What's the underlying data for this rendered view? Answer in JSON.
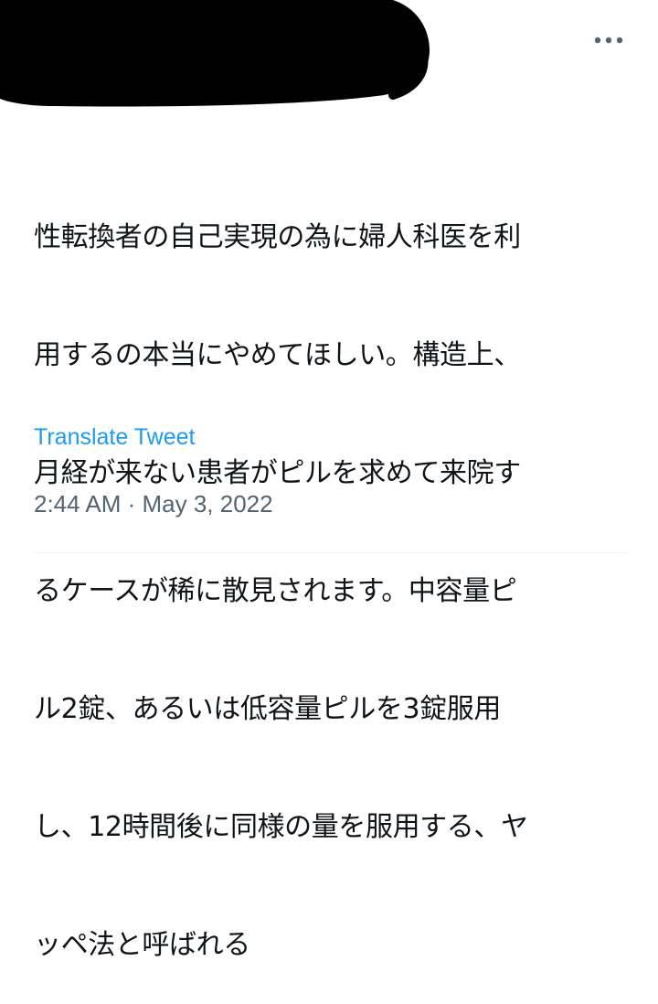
{
  "header": {
    "more_icon": "more-horizontal-icon"
  },
  "tweet": {
    "lines": [
      "性転換者の自己実現の為に婦人科医を利",
      "用するの本当にやめてほしい。構造上、",
      "月経が来ない患者がピルを求めて来院す",
      "るケースが稀に散見されます。中容量ピ",
      "ル2錠、あるいは低容量ピルを3錠服用",
      "し、12時間後に同様の量を服用する、ヤ",
      "ッペ法と呼ばれる"
    ],
    "translate_label": "Translate Tweet",
    "timestamp": "2:44 AM · May 3, 2022"
  },
  "colors": {
    "text": "#0f1419",
    "link": "#1d9bf0",
    "secondary": "#536471",
    "redaction": "#000000"
  }
}
